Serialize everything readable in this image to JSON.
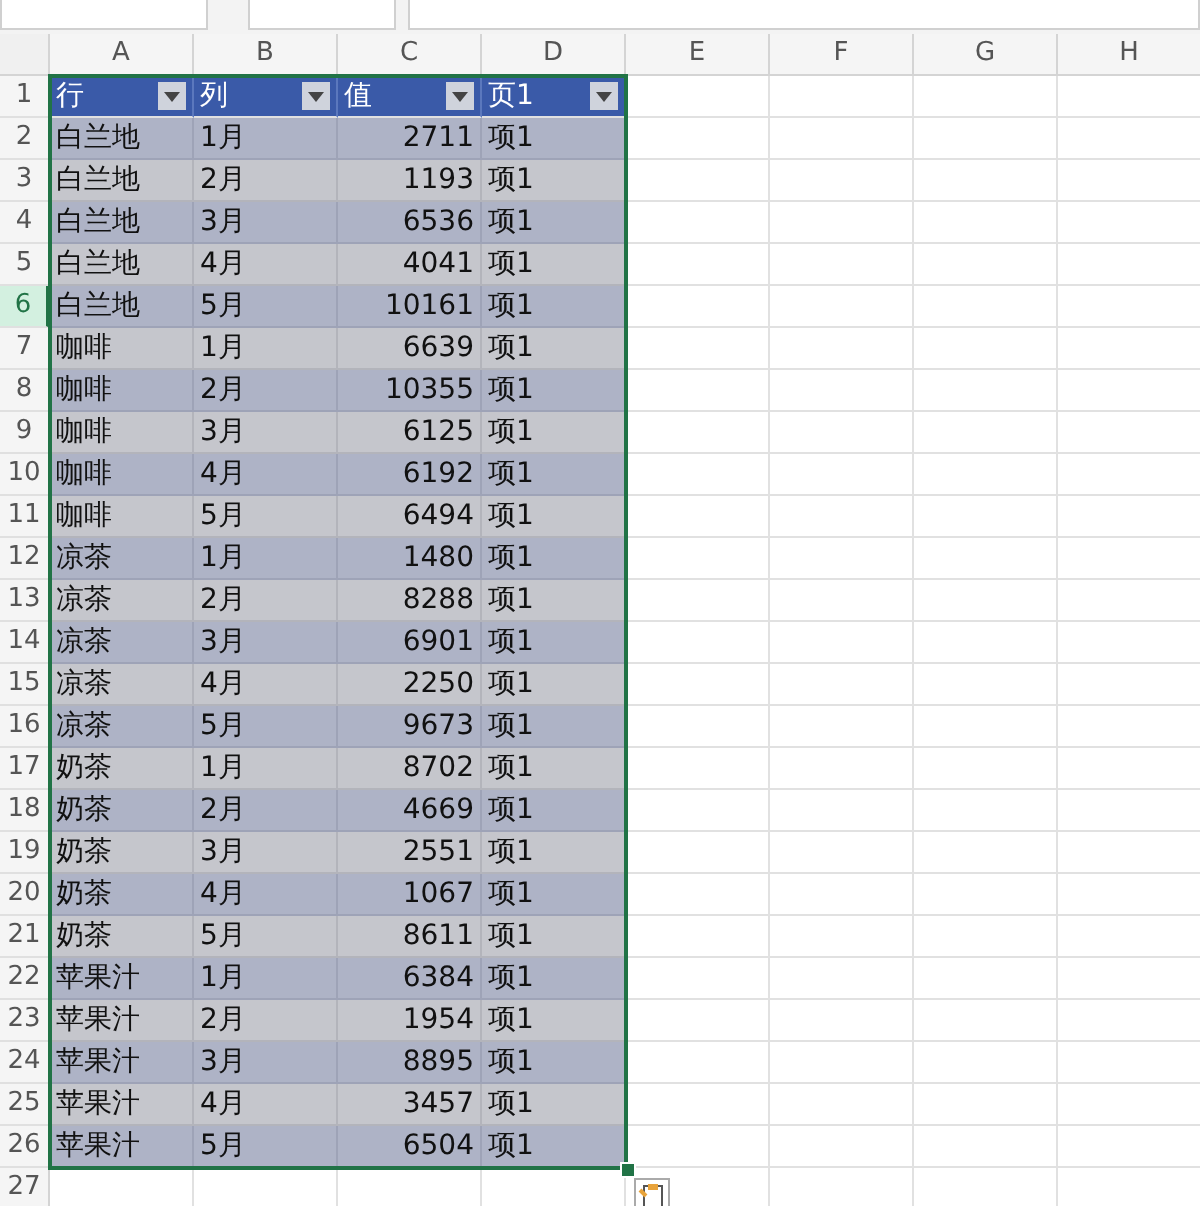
{
  "columns": [
    {
      "label": "A"
    },
    {
      "label": "B"
    },
    {
      "label": "C"
    },
    {
      "label": "D"
    },
    {
      "label": "E"
    },
    {
      "label": "F"
    },
    {
      "label": "G"
    },
    {
      "label": "H"
    }
  ],
  "header_row": {
    "number": "1",
    "selected": false,
    "cells": [
      "行",
      "列",
      "值",
      "页1"
    ]
  },
  "rows": [
    {
      "number": "2",
      "selected": false,
      "cells": [
        "白兰地",
        "1月",
        "2711",
        "项1"
      ]
    },
    {
      "number": "3",
      "selected": false,
      "cells": [
        "白兰地",
        "2月",
        "1193",
        "项1"
      ]
    },
    {
      "number": "4",
      "selected": false,
      "cells": [
        "白兰地",
        "3月",
        "6536",
        "项1"
      ]
    },
    {
      "number": "5",
      "selected": false,
      "cells": [
        "白兰地",
        "4月",
        "4041",
        "项1"
      ]
    },
    {
      "number": "6",
      "selected": true,
      "cells": [
        "白兰地",
        "5月",
        "10161",
        "项1"
      ]
    },
    {
      "number": "7",
      "selected": false,
      "cells": [
        "咖啡",
        "1月",
        "6639",
        "项1"
      ]
    },
    {
      "number": "8",
      "selected": false,
      "cells": [
        "咖啡",
        "2月",
        "10355",
        "项1"
      ]
    },
    {
      "number": "9",
      "selected": false,
      "cells": [
        "咖啡",
        "3月",
        "6125",
        "项1"
      ]
    },
    {
      "number": "10",
      "selected": false,
      "cells": [
        "咖啡",
        "4月",
        "6192",
        "项1"
      ]
    },
    {
      "number": "11",
      "selected": false,
      "cells": [
        "咖啡",
        "5月",
        "6494",
        "项1"
      ]
    },
    {
      "number": "12",
      "selected": false,
      "cells": [
        "凉茶",
        "1月",
        "1480",
        "项1"
      ]
    },
    {
      "number": "13",
      "selected": false,
      "cells": [
        "凉茶",
        "2月",
        "8288",
        "项1"
      ]
    },
    {
      "number": "14",
      "selected": false,
      "cells": [
        "凉茶",
        "3月",
        "6901",
        "项1"
      ]
    },
    {
      "number": "15",
      "selected": false,
      "cells": [
        "凉茶",
        "4月",
        "2250",
        "项1"
      ]
    },
    {
      "number": "16",
      "selected": false,
      "cells": [
        "凉茶",
        "5月",
        "9673",
        "项1"
      ]
    },
    {
      "number": "17",
      "selected": false,
      "cells": [
        "奶茶",
        "1月",
        "8702",
        "项1"
      ]
    },
    {
      "number": "18",
      "selected": false,
      "cells": [
        "奶茶",
        "2月",
        "4669",
        "项1"
      ]
    },
    {
      "number": "19",
      "selected": false,
      "cells": [
        "奶茶",
        "3月",
        "2551",
        "项1"
      ]
    },
    {
      "number": "20",
      "selected": false,
      "cells": [
        "奶茶",
        "4月",
        "1067",
        "项1"
      ]
    },
    {
      "number": "21",
      "selected": false,
      "cells": [
        "奶茶",
        "5月",
        "8611",
        "项1"
      ]
    },
    {
      "number": "22",
      "selected": false,
      "cells": [
        "苹果汁",
        "1月",
        "6384",
        "项1"
      ]
    },
    {
      "number": "23",
      "selected": false,
      "cells": [
        "苹果汁",
        "2月",
        "1954",
        "项1"
      ]
    },
    {
      "number": "24",
      "selected": false,
      "cells": [
        "苹果汁",
        "3月",
        "8895",
        "项1"
      ]
    },
    {
      "number": "25",
      "selected": false,
      "cells": [
        "苹果汁",
        "4月",
        "3457",
        "项1"
      ]
    },
    {
      "number": "26",
      "selected": false,
      "cells": [
        "苹果汁",
        "5月",
        "6504",
        "项1"
      ]
    }
  ],
  "empty_row": {
    "number": "27",
    "selected": false
  }
}
